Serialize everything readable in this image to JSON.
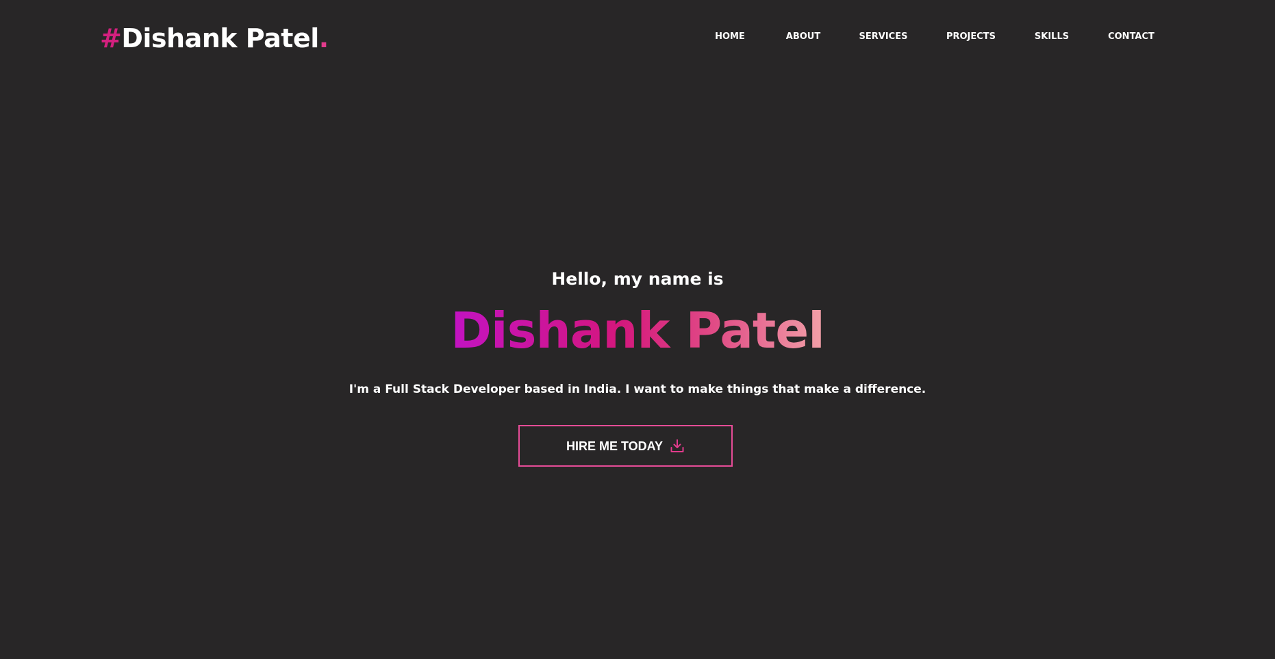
{
  "header": {
    "logo_hash": "#",
    "logo_text": "Dishank Patel",
    "logo_dot": "."
  },
  "nav": {
    "items": [
      {
        "label": "HOME"
      },
      {
        "label": "ABOUT"
      },
      {
        "label": "SERVICES"
      },
      {
        "label": "PROJECTS"
      },
      {
        "label": "SKILLS"
      },
      {
        "label": "CONTACT"
      }
    ]
  },
  "hero": {
    "greeting": "Hello, my name is",
    "name": "Dishank Patel",
    "tagline": "I'm a Full Stack Developer based in India. I want to make things that make a difference.",
    "cta_label": "HIRE ME TODAY",
    "cta_icon": "download-icon"
  },
  "colors": {
    "background": "#282627",
    "accent": "#d4207f",
    "button_border": "#e64c97",
    "gradient_start": "#c213c2",
    "gradient_end": "#f2a1a8"
  }
}
